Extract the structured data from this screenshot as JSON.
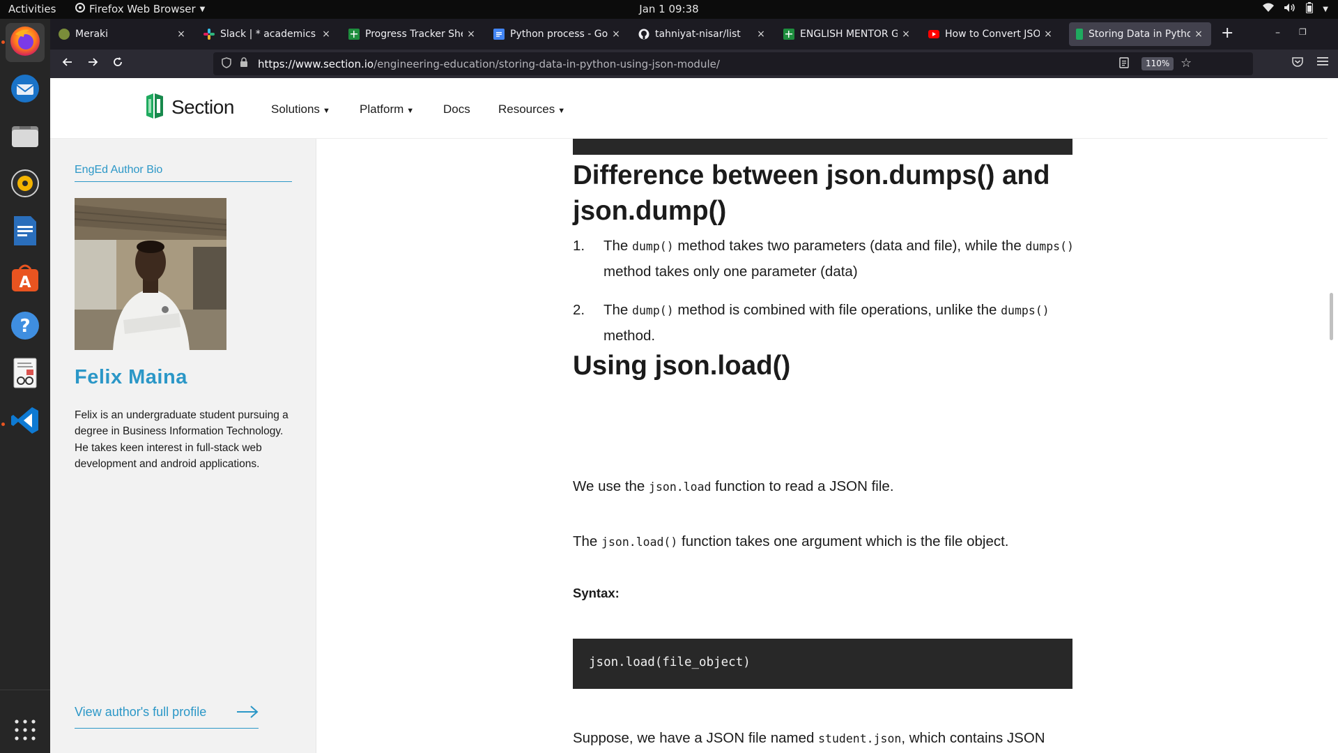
{
  "system_bar": {
    "activities": "Activities",
    "app_name": "Firefox Web Browser",
    "clock": "Jan 1  09:38"
  },
  "browser": {
    "tabs": [
      {
        "title": "Meraki",
        "favicon": "meraki-icon",
        "color": "#7a8c3a"
      },
      {
        "title": "Slack | * academics | N",
        "favicon": "slack-icon",
        "color": "#4a154b"
      },
      {
        "title": "Progress Tracker Sheet",
        "favicon": "sheets-icon",
        "color": "#1e8e3e"
      },
      {
        "title": "Python process - Goog",
        "favicon": "docs-icon",
        "color": "#4285f4"
      },
      {
        "title": "tahniyat-nisar/list",
        "favicon": "github-icon",
        "color": "#24292f"
      },
      {
        "title": "ENGLISH MENTOR GRO",
        "favicon": "sheets-icon",
        "color": "#1e8e3e"
      },
      {
        "title": "How to Convert JSON",
        "favicon": "youtube-icon",
        "color": "#ff0000"
      },
      {
        "title": "Storing Data in Python",
        "favicon": "section-icon",
        "color": "#1faa5f"
      }
    ],
    "url_host": "https://www.section.io",
    "url_path": "/engineering-education/storing-data-in-python-using-json-module/",
    "zoom": "110%"
  },
  "site": {
    "logo_text": "Section",
    "nav": [
      {
        "label": "Solutions",
        "has_caret": true
      },
      {
        "label": "Platform",
        "has_caret": true
      },
      {
        "label": "Docs",
        "has_caret": false
      },
      {
        "label": "Resources",
        "has_caret": true
      }
    ]
  },
  "sidebar": {
    "label": "EngEd Author Bio",
    "author_name": "Felix Maina",
    "bio": "Felix is an undergraduate student pursuing a degree in Business Information Technology. He takes keen interest in full-stack web development and android applications.",
    "profile_link": "View author's full profile"
  },
  "article": {
    "h2_diff": "Difference between json.dumps() and json.dump()",
    "list": [
      {
        "num": "1.",
        "t1": "The ",
        "c1": "dump()",
        "t2": " method takes two parameters (data and file), while the ",
        "c2": "dumps()",
        "t3": " method takes only one parameter (data)"
      },
      {
        "num": "2.",
        "t1": "The ",
        "c1": "dump()",
        "t2": " method is combined with file operations, unlike the ",
        "c2": "dumps()",
        "t3": " method."
      }
    ],
    "h2_load": "Using json.load()",
    "p1_pre": "We use the ",
    "p1_code": "json.load",
    "p1_post": " function to read a JSON file.",
    "p2_pre": "The ",
    "p2_code": "json.load()",
    "p2_post": " function takes one argument which is the file object.",
    "syntax_label": "Syntax:",
    "code_line": "json.load(file_object)",
    "p3_pre": "Suppose, we have a JSON file named ",
    "p3_code": "student.json",
    "p3_post": ", which contains JSON"
  }
}
